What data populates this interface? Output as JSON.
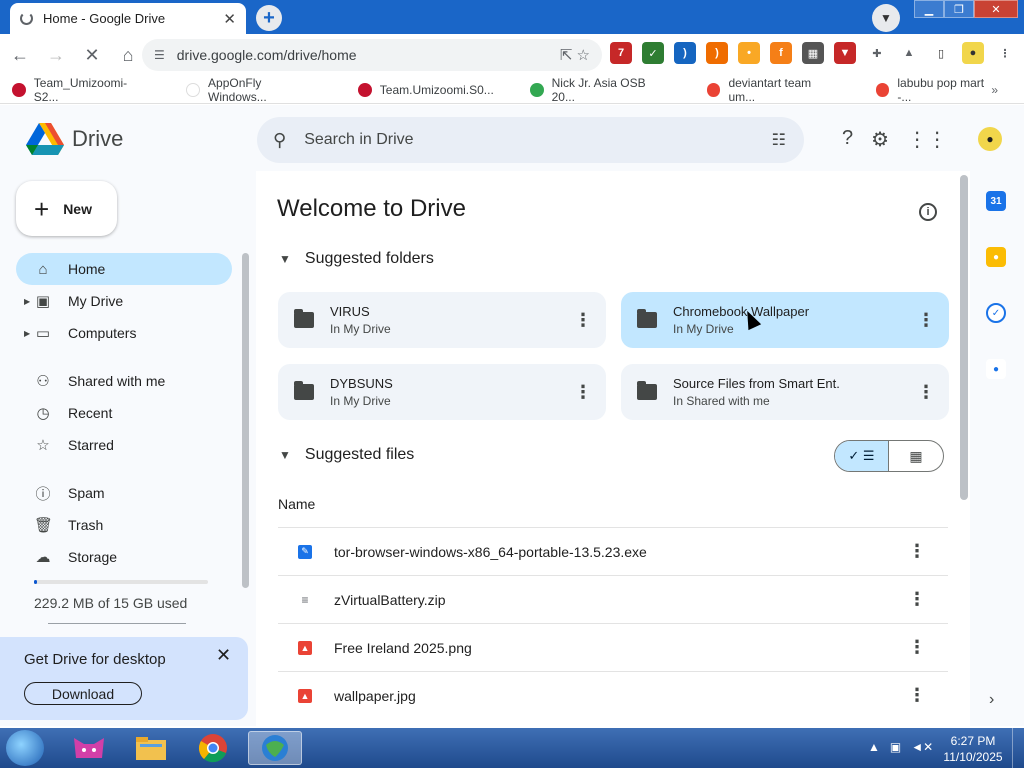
{
  "browser": {
    "tab_title": "Home - Google Drive",
    "tab_close": "✕",
    "new_tab": "+",
    "url": "drive.google.com/drive/home",
    "bookmarks": [
      {
        "label": "Team_Umizoomi-S2...",
        "color": "#c4122f"
      },
      {
        "label": "AppOnFly Windows...",
        "color": "#ffffff"
      },
      {
        "label": "Team.Umizoomi.S0...",
        "color": "#c4122f"
      },
      {
        "label": "Nick Jr. Asia OSB 20...",
        "color": "#33a852"
      },
      {
        "label": "deviantart team um...",
        "color": "#ea4335"
      },
      {
        "label": "labubu pop mart -...",
        "color": "#ea4335"
      }
    ],
    "bookmarks_more": "»",
    "extension_badge": "7"
  },
  "drive": {
    "app_name": "Drive",
    "search_placeholder": "Search in Drive",
    "new_label": "New",
    "nav": [
      {
        "label": "Home",
        "icon": "home-icon",
        "glyph": "⌂",
        "active": true
      },
      {
        "label": "My Drive",
        "icon": "my-drive-icon",
        "glyph": "▣",
        "caret": true
      },
      {
        "label": "Computers",
        "icon": "computers-icon",
        "glyph": "▭",
        "caret": true
      },
      {
        "label": "Shared with me",
        "icon": "shared-icon",
        "glyph": "⚇"
      },
      {
        "label": "Recent",
        "icon": "clock-icon",
        "glyph": "◷"
      },
      {
        "label": "Starred",
        "icon": "star-icon",
        "glyph": "☆"
      },
      {
        "label": "Spam",
        "icon": "spam-icon",
        "glyph": "ⓘ"
      },
      {
        "label": "Trash",
        "icon": "trash-icon",
        "glyph": "🗑"
      },
      {
        "label": "Storage",
        "icon": "cloud-icon",
        "glyph": "☁"
      }
    ],
    "storage_used_text": "229.2 MB of 15 GB used",
    "storage_fraction": 0.015,
    "promo": {
      "title": "Get Drive for desktop",
      "button": "Download",
      "close": "✕"
    },
    "welcome": "Welcome to Drive",
    "suggested_folders_label": "Suggested folders",
    "folders": [
      {
        "name": "VIRUS",
        "location": "In My Drive",
        "selected": false,
        "shared": false
      },
      {
        "name": "Chromebook Wallpaper",
        "location": "In My Drive",
        "selected": true,
        "shared": false
      },
      {
        "name": "DYBSUNS",
        "location": "In My Drive",
        "selected": false,
        "shared": false
      },
      {
        "name": "Source Files from Smart Ent.",
        "location": "In Shared with me",
        "selected": false,
        "shared": true
      }
    ],
    "suggested_files_label": "Suggested files",
    "column_name": "Name",
    "files": [
      {
        "name": "tor-browser-windows-x86_64-portable-13.5.23.exe",
        "kind": "exe",
        "color": "#1a73e8"
      },
      {
        "name": "zVirtualBattery.zip",
        "kind": "zip",
        "color": "#5f6368"
      },
      {
        "name": "Free Ireland 2025.png",
        "kind": "image",
        "color": "#ea4335"
      },
      {
        "name": "wallpaper.jpg",
        "kind": "image",
        "color": "#ea4335"
      }
    ]
  },
  "taskbar": {
    "time": "6:27 PM",
    "date": "11/10/2025"
  }
}
